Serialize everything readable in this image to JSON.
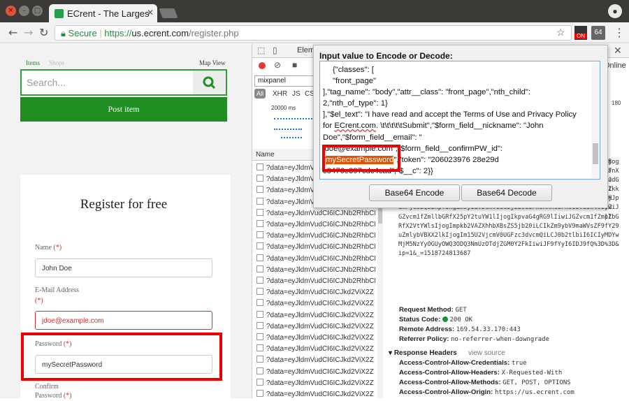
{
  "browser": {
    "tab_title": "ECrent - The Larges",
    "url_secure": "Secure",
    "url_scheme": "https://",
    "url_host": "us.ecrent.com",
    "url_path": "/register.php",
    "ext_on_label": "ON",
    "ext_64_label": "64"
  },
  "site": {
    "nav_items": "Items",
    "nav_shops": "Shops",
    "map_view": "Map View",
    "search_placeholder": "Search...",
    "post_item": "Post item",
    "register_title": "Register for free",
    "name_label": "Name",
    "name_value": "John Doe",
    "email_label": "E-Mail Address",
    "email_value": "jdoe@example.com",
    "password_label": "Password",
    "password_value": "mySecretPassword",
    "confirm_label": "Confirm",
    "confirm_label2": "Password",
    "required_mark": "(*)"
  },
  "devtools": {
    "elements_tab": "Eleme",
    "online": "Online",
    "filter_value": "mixpanel",
    "types": [
      "All",
      "XHR",
      "JS",
      "CS"
    ],
    "timeline_label": "20000 ms",
    "yaxis_label": "180",
    "name_header": "Name",
    "requests": [
      "?data=eyJldmVudCI6ICJNb2RhbCB",
      "?data=eyJldmVudCI6ICJNb2RhbCB",
      "?data=eyJldmVudCI6ICJNb2RhbCB",
      "?data=eyJldmVudCI6ICJNb2RhbCB",
      "?data=eyJldmVudCI6ICJNb2RhbCB",
      "?data=eyJldmVudCI6ICJNb2RhbCB",
      "?data=eyJldmVudCI6ICJNb2RhbCB",
      "?data=eyJldmVudCI6ICJNb2RhbCB",
      "?data=eyJldmVudCI6ICJNb2RhbCB",
      "?data=eyJldmVudCI6ICJNb2RhbCB",
      "?data=eyJldmVudCI6ICJNb2RhbCB",
      "?data=eyJldmVudCI6ICJNb2RhbCB",
      "?data=eyJldmVudCI6ICJNb2RhbCB",
      "?data=eyJldmVudCI6ICJNb2RhbCB",
      "?data=eyJldmVudCI6ICJNb2RhbCB",
      "?data=eyJldmVudCI6ICJNb2RhbCB",
      "?data=eyJldmVudCI6ICJNb2RhbCB",
      "?data=eyJldmVudCI6ICJNb2RhbCB",
      "?data=eyJldmVudCI6ICJNb2RhbCB",
      "?data=eyJldmVudCI6ICJNb2RhbCB",
      "?data=eyJldmVudCI6ICJNb2RhbCB"
    ],
    "requests_mid": [
      "?data=eyJldmVudCI6ICJNb2RhbCB",
      "?data=eyJldmVudCI6ICJNb2RhbCB",
      "?data=eyJldmVudCI6ICJNb2RhbCB",
      "?data=eyJldmVudCI6ICJNb2RhbCB",
      "?data=eyJldmVudCI6ICJNb2RhbCB",
      "?data=eyJldmVudCI6ICJNb2RhbCB",
      "?data=eyJldmVudCI6ICJNb2RhbCB",
      "?data=eyJldmVudCI6ICJNb2RhbCB",
      "?data=eyJldmVudCI6ICJNb2RhbCB",
      "?data=eyJldmVudCI6ICJNb2RhbCB",
      "?data=eyJldmVudCI6ICJNb2RhbCB",
      "?data=eyJldmVudCI6ICJNb2RhbCB",
      "?data=eyJldmVudCI6ICJNb2RhbCB",
      "?data=eyJldmVudCI6ICJNb2RhbCB",
      "?data=eyJldmVudCI6ICJNb2RhbCB"
    ],
    "request_prefix_a": "?data=eyJldmVudCI6ICJNb2RhbCB",
    "request_prefix_b": "?data=eyJldmVudCI6ICJkd2ViX2Z",
    "payload_right_col": "iB\n9J\nCJ\npZ\nFj\nyZ\npZ",
    "payload": "6ICJ3aWRlX2xheW91dCIsIm50aF9jaGlsZCI6IDEsIm50aF9vZl90eXBlIjogMX0sCiAgICB7ImNsYXNzZXMiOiBbCiAgICAiZnJvbnRfcGFnZSIKXSwidGFnX25hbWUiOiAiYm9keSIsImF0dHJfX2NsYXNzIjogImZyb250X3BhZ2UiLCJudGhfY2hpbGQiOiAyLCJudGhfb2ZfdHlwZSI6IDF9Cl0sIlRlbF90ZXh0IjogIkkgaGF2ZSByZWFkIGFuZCBhY2NlcHQgdGhlIFRlcm1zIG9mIFVzZSBhbmQgUHJpdmFjeSBQb2xpY3kgZm9yIEVDcmVudC5jb20uIFx0XHRcdFx0U3VibWl0IiwiJGZvcm1fZmllbGRfX25pY2tuYW1lIjogIkpvaG4gRG9lIiwiJGZvcm1fZmllbGRfX2VtYWlsIjogImpkb2VAZXhhbXBsZS5jb20iLCIkZm9ybV9maWVsZF9fY29uZmlybVBXX2lkIjogIm15U2VjcmV0UGFzc3dvcmQiLCJ0b2tlbiI6ICIyMDYwMjM5NzYyOGUyOWQ3ODQ3NmUzOTdjZGM0Y2FkIiwiJF9fYyI6IDJ9fQ%3D%3D&ip=1&_=1518724813687",
    "request_method_label": "Request Method:",
    "request_method": "GET",
    "status_code_label": "Status Code:",
    "status_code": "200  OK",
    "remote_address_label": "Remote Address:",
    "remote_address": "169.54.33.170:443",
    "referrer_policy_label": "Referrer Policy:",
    "referrer_policy": "no-referrer-when-downgrade",
    "response_headers": "Response Headers",
    "view_source": "view source",
    "headers": [
      {
        "k": "Access-Control-Allow-Credentials:",
        "v": "true"
      },
      {
        "k": "Access-Control-Allow-Headers:",
        "v": "X-Requested-With"
      },
      {
        "k": "Access-Control-Allow-Methods:",
        "v": "GET, POST, OPTIONS"
      },
      {
        "k": "Access-Control-Allow-Origin:",
        "v": "https://us.ecrent.com"
      }
    ]
  },
  "dialog": {
    "title": "Input value to Encode or Decode:",
    "line1": "{\"classes\": [",
    "line2": "\"front_page\"",
    "line3": "],\"tag_name\": \"body\",\"attr__class\": \"front_page\",\"nth_child\": 2,\"nth_of_type\": 1}",
    "line4a": "],\"$el_text\": \"I have read and accept the Terms of Use and Privacy Policy for ",
    "line4b": "ECrent.com",
    "line4c": ". \\t\\t\\t\\t\\tSubmit\",\"$form_field__nickname\": \"John Doe\",\"$form_field__email\": \"",
    "line5": "jdoe@example.com\",\"$form_field__confirmPW_id\": \"",
    "password_word": "mySecretPassword",
    "line6": "\",\"token\": \"206023976 28e29d c8476e397cdc4cad\",\"$__c\": 2}}",
    "encode_button": "Base64 Encode",
    "decode_button": "Base64 Decode"
  }
}
